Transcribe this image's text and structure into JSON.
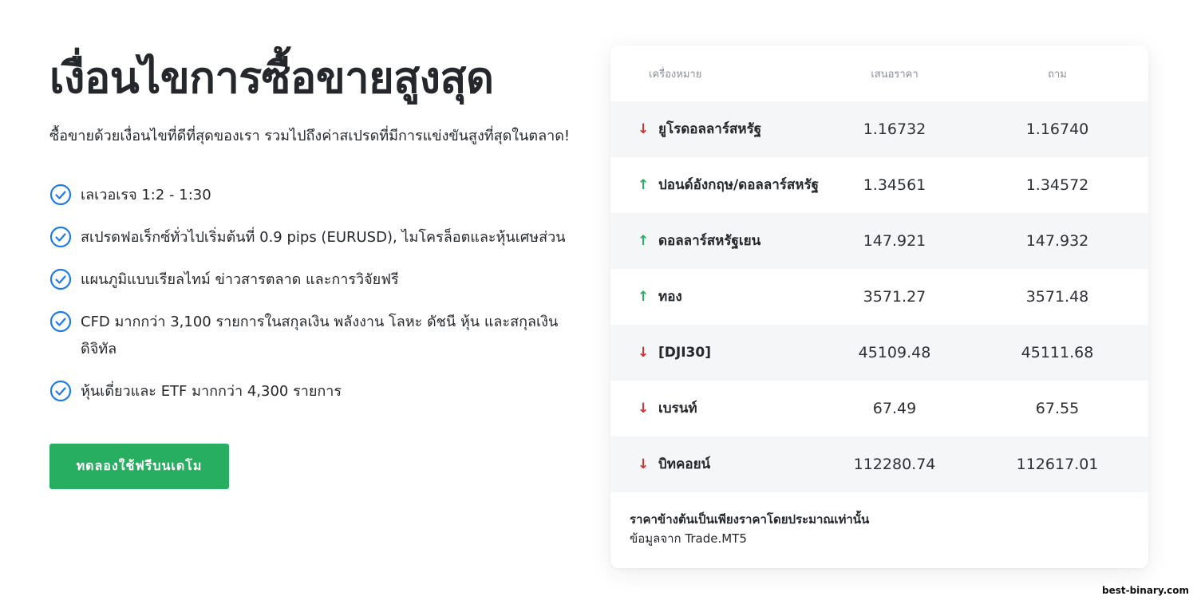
{
  "hero": {
    "title": "เงื่อนไขการซื้อขายสูงสุด",
    "subtitle": "ซื้อขายด้วยเงื่อนไขที่ดีที่สุดของเรา รวมไปถึงค่าสเปรดที่มีการแข่งขันสูงที่สุดในตลาด!"
  },
  "features": [
    "เลเวอเรจ 1:2 - 1:30",
    "สเปรดฟอเร็กซ์ทั่วไปเริ่มต้นที่ 0.9 pips (EURUSD), ไมโครล็อตและหุ้นเศษส่วน",
    "แผนภูมิแบบเรียลไทม์ ข่าวสารตลาด และการวิจัยฟรี",
    "CFD มากกว่า 3,100 รายการในสกุลเงิน พลังงาน โลหะ ดัชนี หุ้น และสกุลเงินดิจิทัล",
    "หุ้นเดี่ยวและ ETF มากกว่า 4,300 รายการ"
  ],
  "cta_label": "ทดลองใช้ฟรีบนเดโม",
  "icons": {
    "feature": "check-circle-icon",
    "down": "arrow-down-icon",
    "up": "arrow-up-icon"
  },
  "colors": {
    "accent": "#27ae60",
    "check": "#1e7be6",
    "down": "#d32f2f",
    "up": "#27ae60"
  },
  "table": {
    "headers": [
      "เครื่องหมาย",
      "เสนอราคา",
      "ถาม"
    ],
    "rows": [
      {
        "name": "ยูโรดอลลาร์สหรัฐ",
        "bid": "1.16732",
        "ask": "1.16740",
        "dir": "down"
      },
      {
        "name": "ปอนด์อังกฤษ/ดอลลาร์สหรัฐ",
        "bid": "1.34561",
        "ask": "1.34572",
        "dir": "up"
      },
      {
        "name": "ดอลลาร์สหรัฐเยน",
        "bid": "147.921",
        "ask": "147.932",
        "dir": "up"
      },
      {
        "name": "ทอง",
        "bid": "3571.27",
        "ask": "3571.48",
        "dir": "up"
      },
      {
        "name": "[DJI30]",
        "bid": "45109.48",
        "ask": "45111.68",
        "dir": "down"
      },
      {
        "name": "เบรนท์",
        "bid": "67.49",
        "ask": "67.55",
        "dir": "down"
      },
      {
        "name": "บิทคอยน์",
        "bid": "112280.74",
        "ask": "112617.01",
        "dir": "down"
      }
    ],
    "note_line1": "ราคาข้างต้นเป็นเพียงราคาโดยประมาณเท่านั้น",
    "note_line2": "ข้อมูลจาก Trade.MT5"
  },
  "watermark": "best-binary.com"
}
